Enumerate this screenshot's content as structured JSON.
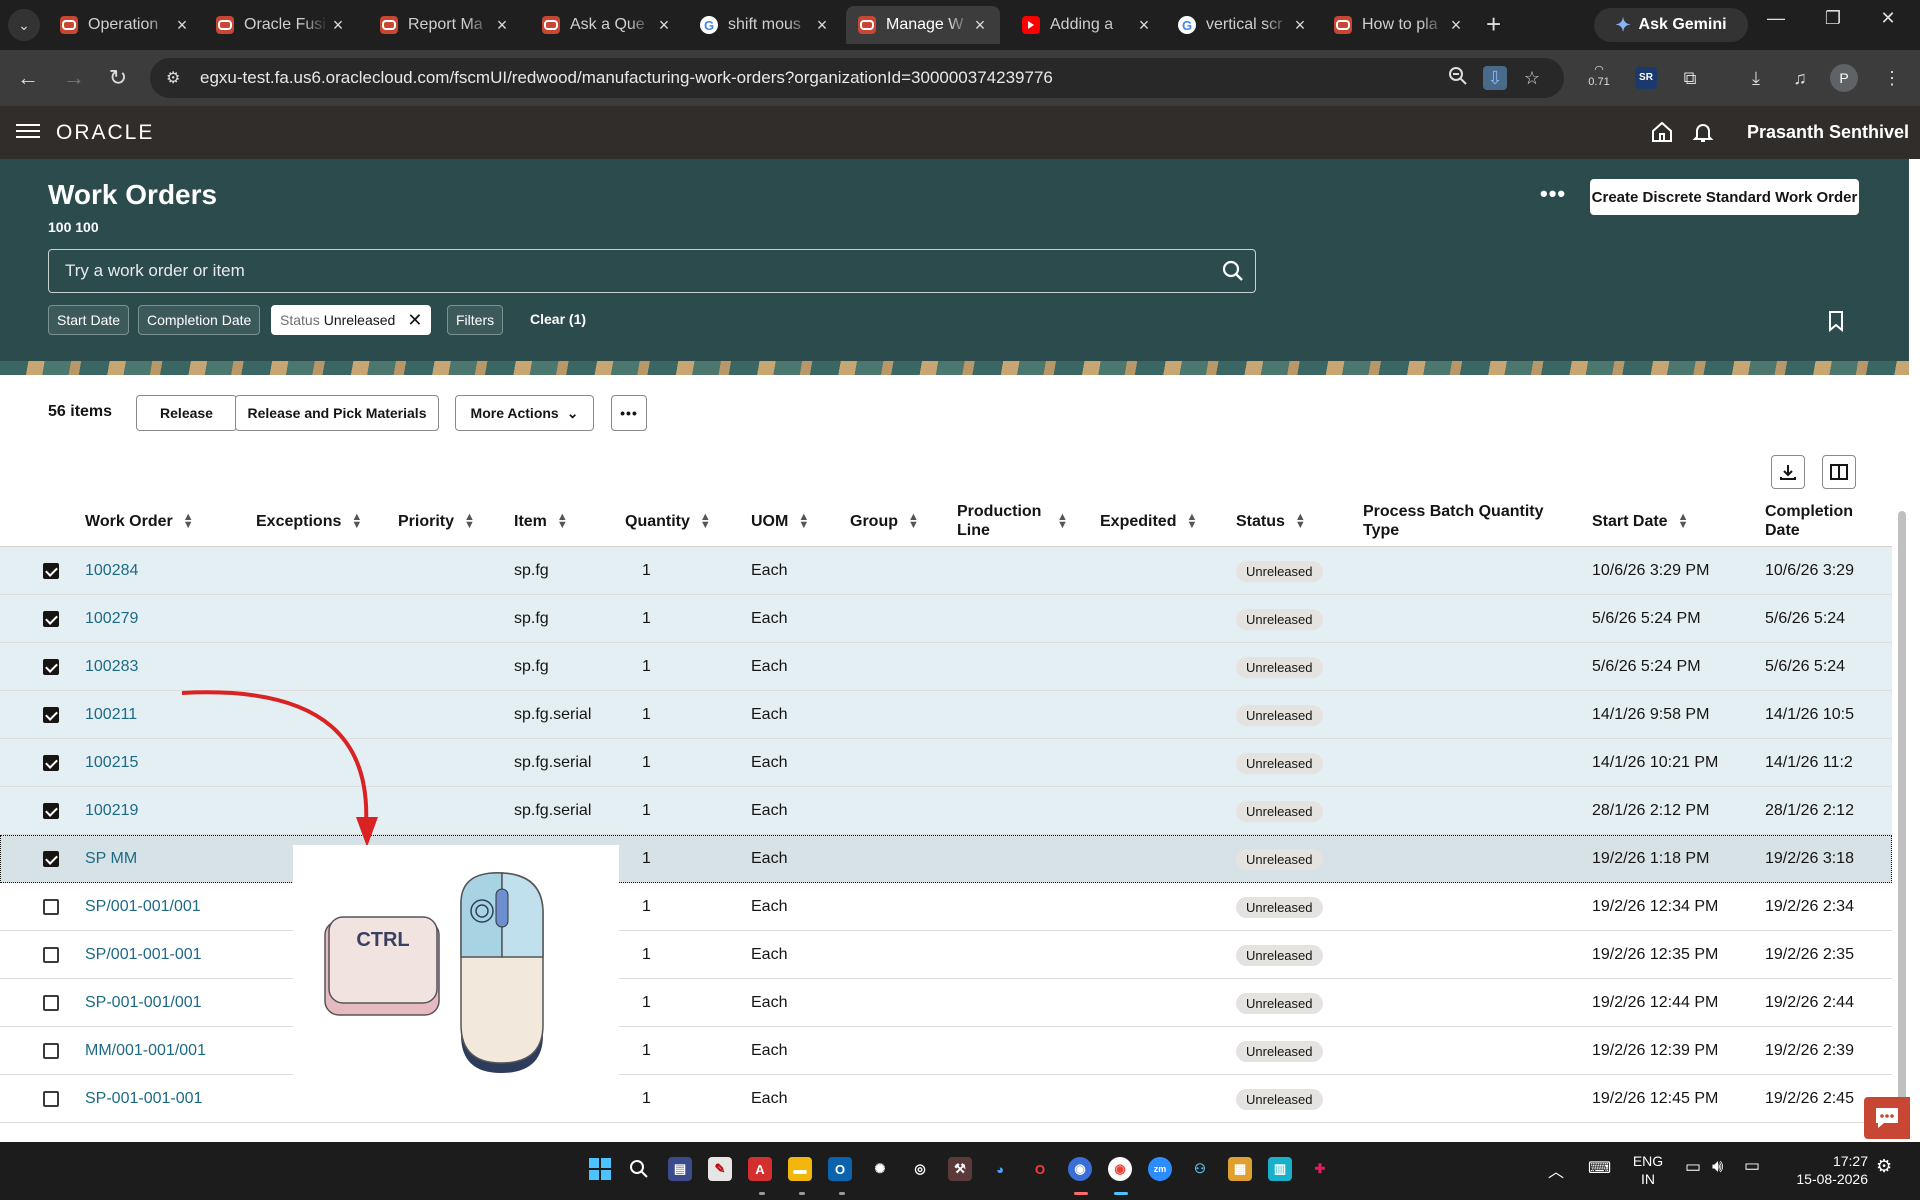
{
  "browser": {
    "tabs": [
      {
        "title": "Operation",
        "favicon": "oracle"
      },
      {
        "title": "Oracle Fusi",
        "favicon": "oracle"
      },
      {
        "title": "Report Ma",
        "favicon": "oracle"
      },
      {
        "title": "Ask a Que",
        "favicon": "oracle"
      },
      {
        "title": "shift mous",
        "favicon": "google"
      },
      {
        "title": "Manage W",
        "favicon": "oracle",
        "active": true
      },
      {
        "title": "Adding a",
        "favicon": "youtube"
      },
      {
        "title": "vertical scr",
        "favicon": "google"
      },
      {
        "title": "How to pla",
        "favicon": "oracle"
      }
    ],
    "gemini_label": "Ask Gemini",
    "url": "egxu-test.fa.us6.oraclecloud.com/fscmUI/redwood/manufacturing-work-orders?organizationId=300000374239776",
    "perf_value": "0.71",
    "sr_ext_label": "SR",
    "profile_initial": "P"
  },
  "app": {
    "logo": "ORACLE",
    "user_name": "Prasanth Senthivel"
  },
  "page": {
    "title": "Work Orders",
    "subtitle": "100 100",
    "create_button": "Create Discrete Standard Work Order",
    "search_placeholder": "Try a work order or item",
    "filters": {
      "start_date": "Start Date",
      "completion_date": "Completion Date",
      "status_prefix": "Status",
      "status_value": "Unreleased",
      "filters_label": "Filters",
      "clear_label": "Clear (1)"
    }
  },
  "toolbar": {
    "items_count": "56 items",
    "release": "Release",
    "release_pick": "Release and Pick Materials",
    "more_actions": "More Actions"
  },
  "table": {
    "columns": {
      "work_order": "Work Order",
      "exceptions": "Exceptions",
      "priority": "Priority",
      "item": "Item",
      "quantity": "Quantity",
      "uom": "UOM",
      "group": "Group",
      "production_line": "Production Line",
      "expedited": "Expedited",
      "status": "Status",
      "pbq_type": "Process Batch Quantity Type",
      "start_date": "Start Date",
      "completion_date": "Completion Date"
    },
    "rows": [
      {
        "checked": true,
        "work_order": "100284",
        "item": "sp.fg",
        "quantity": "1",
        "uom": "Each",
        "status": "Unreleased",
        "start_date": "10/6/26 3:29 PM",
        "completion_date": "10/6/26 3:29"
      },
      {
        "checked": true,
        "work_order": "100279",
        "item": "sp.fg",
        "quantity": "1",
        "uom": "Each",
        "status": "Unreleased",
        "start_date": "5/6/26 5:24 PM",
        "completion_date": "5/6/26 5:24"
      },
      {
        "checked": true,
        "work_order": "100283",
        "item": "sp.fg",
        "quantity": "1",
        "uom": "Each",
        "status": "Unreleased",
        "start_date": "5/6/26 5:24 PM",
        "completion_date": "5/6/26 5:24"
      },
      {
        "checked": true,
        "work_order": "100211",
        "item": "sp.fg.serial",
        "quantity": "1",
        "uom": "Each",
        "status": "Unreleased",
        "start_date": "14/1/26 9:58 PM",
        "completion_date": "14/1/26 10:5"
      },
      {
        "checked": true,
        "work_order": "100215",
        "item": "sp.fg.serial",
        "quantity": "1",
        "uom": "Each",
        "status": "Unreleased",
        "start_date": "14/1/26 10:21 PM",
        "completion_date": "14/1/26 11:2"
      },
      {
        "checked": true,
        "work_order": "100219",
        "item": "sp.fg.serial",
        "quantity": "1",
        "uom": "Each",
        "status": "Unreleased",
        "start_date": "28/1/26 2:12 PM",
        "completion_date": "28/1/26 2:12"
      },
      {
        "checked": true,
        "work_order": "SP MM",
        "item": "",
        "quantity": "1",
        "uom": "Each",
        "status": "Unreleased",
        "start_date": "19/2/26 1:18 PM",
        "completion_date": "19/2/26 3:18",
        "focused": true
      },
      {
        "checked": false,
        "work_order": "SP/001-001/001",
        "item": "",
        "quantity": "1",
        "uom": "Each",
        "status": "Unreleased",
        "start_date": "19/2/26 12:34 PM",
        "completion_date": "19/2/26 2:34"
      },
      {
        "checked": false,
        "work_order": "SP/001-001-001",
        "item": "",
        "quantity": "1",
        "uom": "Each",
        "status": "Unreleased",
        "start_date": "19/2/26 12:35 PM",
        "completion_date": "19/2/26 2:35"
      },
      {
        "checked": false,
        "work_order": "SP-001-001/001",
        "item": "",
        "quantity": "1",
        "uom": "Each",
        "status": "Unreleased",
        "start_date": "19/2/26 12:44 PM",
        "completion_date": "19/2/26 2:44"
      },
      {
        "checked": false,
        "work_order": "MM/001-001/001",
        "item": "",
        "quantity": "1",
        "uom": "Each",
        "status": "Unreleased",
        "start_date": "19/2/26 12:39 PM",
        "completion_date": "19/2/26 2:39"
      },
      {
        "checked": false,
        "work_order": "SP-001-001-001",
        "item": "",
        "quantity": "1",
        "uom": "Each",
        "status": "Unreleased",
        "start_date": "19/2/26 12:45 PM",
        "completion_date": "19/2/26 2:45"
      }
    ]
  },
  "overlay": {
    "ctrl_key_label": "CTRL"
  },
  "taskbar": {
    "language_line1": "ENG",
    "language_line2": "IN",
    "time": "17:27",
    "date": "15-08-2026"
  }
}
